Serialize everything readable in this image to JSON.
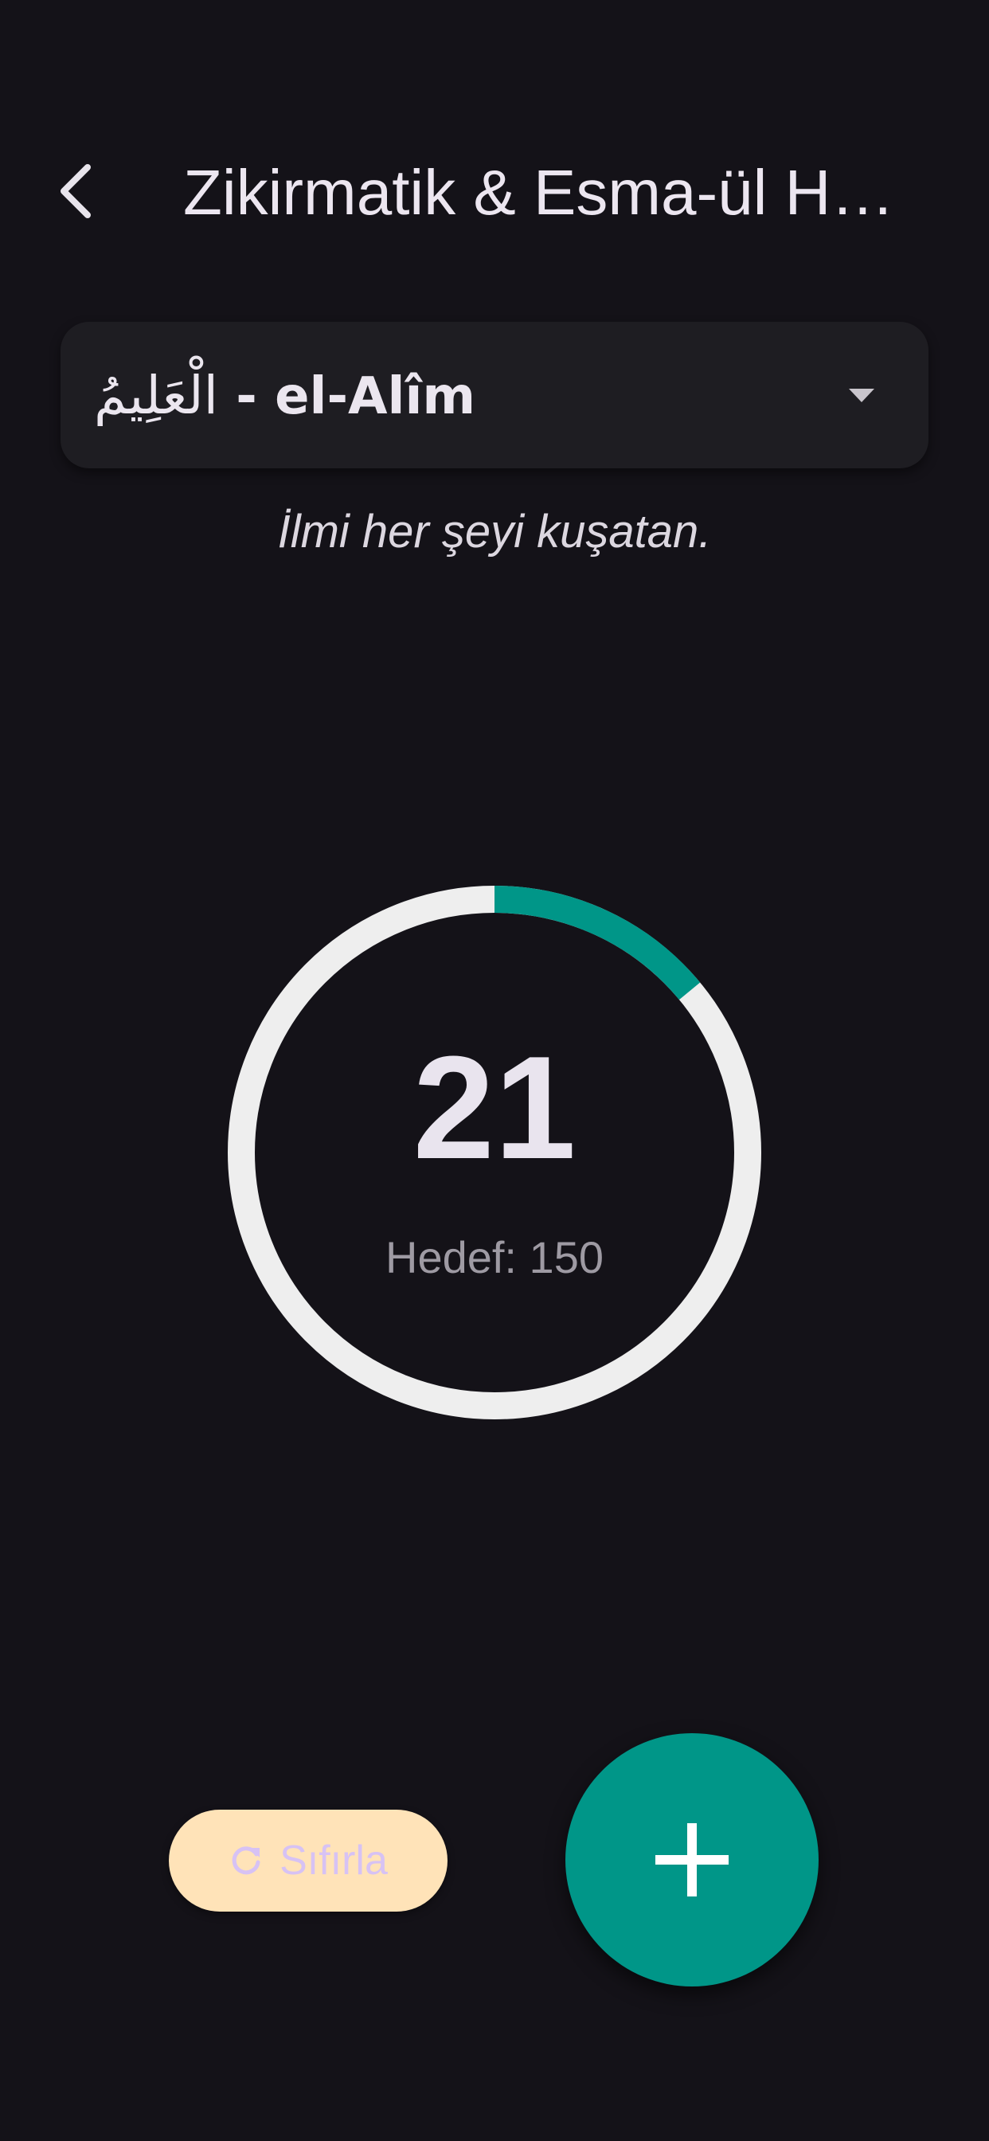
{
  "app_bar": {
    "title": "Zikirmatik & Esma-ül Hüsna"
  },
  "selector": {
    "arabic": "الْعَلِيمُ",
    "separator": " - ",
    "name": "el-Alîm"
  },
  "meaning": "İlmi her şeyi kuşatan.",
  "counter": {
    "count": "21",
    "target_label": "Hedef: 150",
    "count_value": 21,
    "target_value": 150
  },
  "actions": {
    "reset_label": "Sıfırla"
  },
  "colors": {
    "background": "#141218",
    "progress": "#009688",
    "ring_track": "#eeeeee",
    "reset_bg": "#ffe3b8",
    "reset_fg": "#d7c2f4",
    "fab": "#009688"
  },
  "icons": {
    "back": "chevron-left-icon",
    "dropdown": "caret-down-icon",
    "reset": "refresh-icon",
    "add": "plus-icon"
  }
}
